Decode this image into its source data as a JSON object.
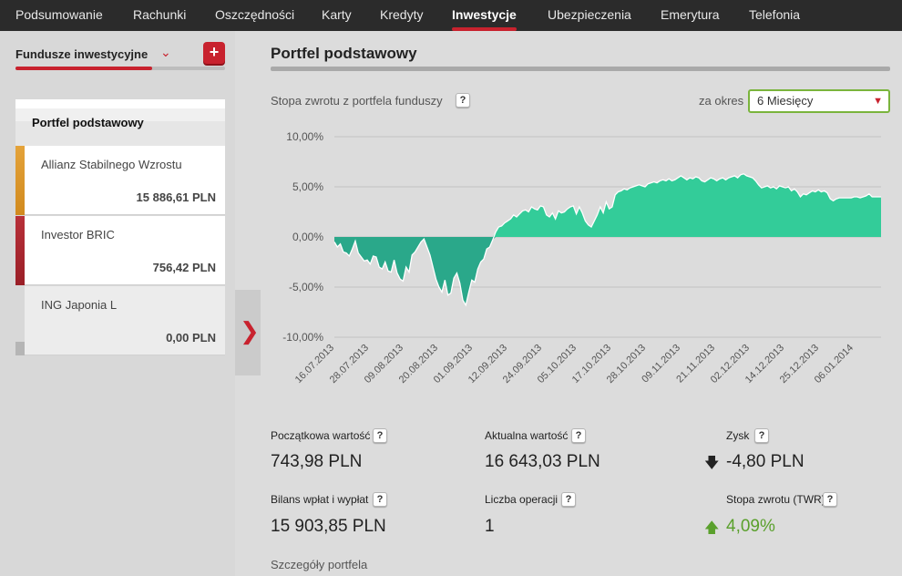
{
  "nav": {
    "items": [
      {
        "label": "Podsumowanie"
      },
      {
        "label": "Rachunki"
      },
      {
        "label": "Oszczędności"
      },
      {
        "label": "Karty"
      },
      {
        "label": "Kredyty"
      },
      {
        "label": "Inwestycje",
        "active": true
      },
      {
        "label": "Ubezpieczenia"
      },
      {
        "label": "Emerytura"
      },
      {
        "label": "Telefonia"
      }
    ]
  },
  "sidebar": {
    "header": "Fundusze inwestycyjne",
    "add_icon": "+",
    "chevron_icon": "chevron-down-icon",
    "portfolio": "Portfel podstawowy",
    "funds": [
      {
        "name": "Allianz Stabilnego Wzrostu",
        "value": "15 886,61 PLN",
        "color": "#e09a2a"
      },
      {
        "name": "Investor BRIC",
        "value": "756,42 PLN",
        "color": "#b3262e"
      },
      {
        "name": "ING Japonia L",
        "value": "0,00 PLN",
        "color": "#c8c8c8"
      }
    ],
    "collapse_icon": "chevron-right-icon"
  },
  "main": {
    "title": "Portfel podstawowy",
    "subtitle": "Stopa zwrotu z portfela funduszy",
    "help": "?",
    "period_label": "za okres",
    "period_value": "6 Miesięcy",
    "stats": {
      "initial_label": "Początkowa wartość",
      "initial_value": "743,98 PLN",
      "current_label": "Aktualna wartość",
      "current_value": "16 643,03 PLN",
      "profit_label": "Zysk",
      "profit_value": "-4,80 PLN",
      "balance_label": "Bilans wpłat i wypłat",
      "balance_value": "15 903,85 PLN",
      "ops_label": "Liczba operacji",
      "ops_value": "1",
      "twr_label": "Stopa zwrotu (TWR)",
      "twr_value": "4,09%"
    },
    "details_label": "Szczegóły portfela"
  },
  "chart_data": {
    "type": "area",
    "ylim": [
      -10,
      10
    ],
    "y_ticks": [
      10,
      5,
      0,
      -5,
      -10
    ],
    "y_tick_labels": [
      "10,00%",
      "5,00%",
      "0,00%",
      "-5,00%",
      "-10,00%"
    ],
    "x_tick_labels": [
      "16.07.2013",
      "28.07.2013",
      "09.08.2013",
      "20.08.2013",
      "01.09.2013",
      "12.09.2013",
      "24.09.2013",
      "05.10.2013",
      "17.10.2013",
      "28.10.2013",
      "09.11.2013",
      "21.11.2013",
      "02.12.2013",
      "14.12.2013",
      "25.12.2013",
      "06.01.2014"
    ],
    "positive_color": "#33cc99",
    "negative_color": "#2aa88a",
    "x": [
      0,
      1,
      2,
      3,
      4,
      5,
      6,
      7,
      8,
      9,
      10,
      11,
      12,
      13,
      14,
      15,
      16,
      17,
      18,
      19,
      20,
      21,
      22,
      23,
      24,
      25,
      26,
      27,
      28,
      29,
      30,
      31,
      32,
      33,
      34,
      35,
      36,
      37,
      38,
      39,
      40,
      41,
      42,
      43,
      44,
      45,
      46,
      47,
      48,
      49,
      50,
      51,
      52,
      53,
      54,
      55,
      56,
      57,
      58,
      59,
      60,
      61,
      62,
      63,
      64,
      65,
      66,
      67,
      68,
      69,
      70,
      71,
      72,
      73,
      74,
      75,
      76,
      77,
      78,
      79,
      80,
      81,
      82,
      83,
      84,
      85,
      86,
      87,
      88,
      89,
      90,
      91,
      92,
      93,
      94,
      95,
      96,
      97,
      98,
      99,
      100,
      101,
      102,
      103,
      104,
      105,
      106,
      107,
      108,
      109,
      110,
      111,
      112,
      113,
      114,
      115,
      116,
      117,
      118,
      119,
      120,
      121,
      122,
      123,
      124,
      125,
      126,
      127,
      128,
      129,
      130,
      131,
      132,
      133,
      134,
      135,
      136,
      137,
      138,
      139,
      140,
      141,
      142,
      143,
      144,
      145,
      146,
      147,
      148,
      149,
      150,
      151,
      152,
      153,
      154,
      155,
      156,
      157,
      158,
      159,
      160,
      161,
      162,
      163,
      164,
      165,
      166,
      167,
      168,
      169,
      170,
      171,
      172,
      173,
      174,
      175,
      176,
      177,
      178,
      179
    ],
    "values": [
      -0.5,
      -1.0,
      -0.7,
      -1.5,
      -1.6,
      -1.9,
      -1.2,
      -0.4,
      -1.6,
      -2.0,
      -2.4,
      -2.3,
      -2.7,
      -1.9,
      -2.0,
      -3.0,
      -3.2,
      -2.5,
      -3.4,
      -3.5,
      -2.3,
      -3.6,
      -4.2,
      -4.4,
      -3.0,
      -3.5,
      -1.8,
      -1.5,
      -1.0,
      -0.5,
      -0.2,
      -1.0,
      -1.8,
      -3.0,
      -4.2,
      -5.0,
      -5.5,
      -4.3,
      -5.8,
      -5.6,
      -4.1,
      -3.6,
      -4.6,
      -6.3,
      -6.8,
      -5.5,
      -4.3,
      -4.5,
      -3.2,
      -2.5,
      -2.2,
      -1.2,
      -1.0,
      -0.3,
      0.5,
      1.0,
      1.1,
      1.4,
      1.6,
      1.8,
      2.2,
      2.0,
      2.3,
      2.6,
      2.7,
      2.5,
      3.0,
      2.8,
      2.7,
      3.1,
      3.0,
      2.2,
      2.0,
      2.4,
      1.8,
      2.6,
      2.4,
      2.5,
      2.8,
      3.0,
      3.1,
      2.3,
      3.0,
      2.4,
      1.6,
      1.2,
      1.0,
      1.6,
      2.2,
      3.0,
      2.4,
      3.5,
      2.8,
      3.0,
      4.2,
      4.5,
      4.6,
      4.8,
      4.7,
      4.9,
      5.0,
      5.1,
      5.2,
      5.1,
      5.0,
      5.3,
      5.4,
      5.5,
      5.4,
      5.6,
      5.7,
      5.6,
      5.8,
      5.6,
      5.7,
      5.9,
      6.1,
      5.9,
      5.7,
      5.9,
      5.8,
      6.0,
      5.9,
      5.6,
      5.5,
      5.7,
      5.9,
      5.8,
      5.6,
      5.8,
      5.9,
      5.7,
      5.9,
      6.0,
      6.1,
      5.9,
      6.2,
      6.3,
      6.1,
      6.0,
      5.9,
      5.6,
      5.2,
      4.9,
      5.0,
      5.1,
      4.9,
      5.0,
      4.8,
      5.1,
      5.0,
      4.9,
      5.0,
      4.6,
      4.8,
      4.5,
      4.0,
      4.3,
      4.2,
      4.4,
      4.6,
      4.5,
      4.7,
      4.5,
      4.6,
      4.4,
      3.8,
      3.6,
      3.8,
      3.9,
      3.9,
      3.9,
      3.9,
      3.9,
      4.0,
      4.0,
      3.9,
      4.0,
      4.1,
      4.3,
      4.0,
      4.0,
      4.0,
      4.0
    ]
  }
}
